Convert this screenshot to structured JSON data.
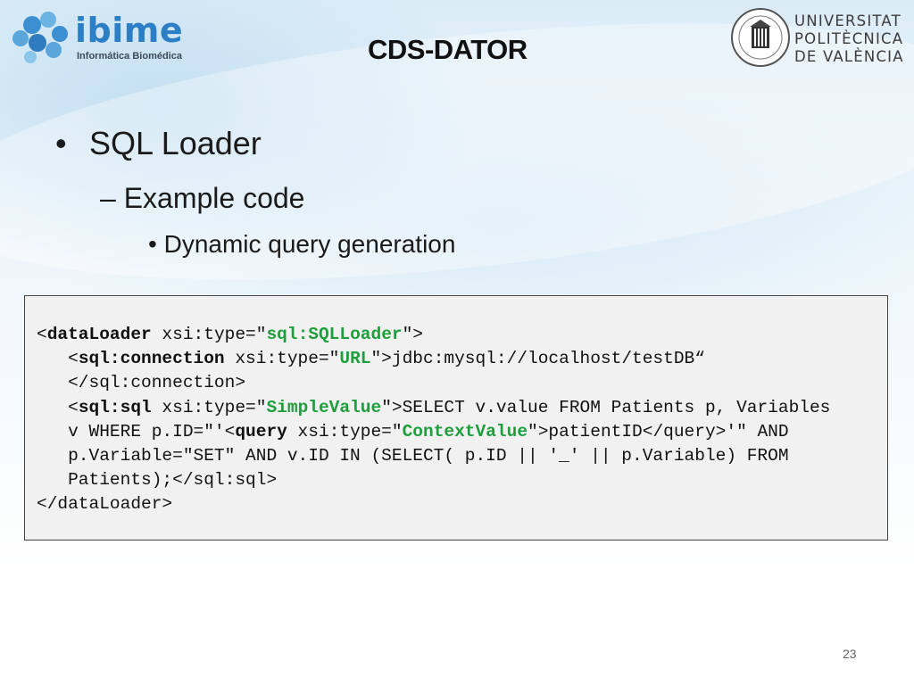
{
  "header": {
    "logo_name": "ibime",
    "logo_subtitle": "Informática Biomédica",
    "title": "CDS-DATOR",
    "university": [
      "UNIVERSITAT",
      "POLITÈCNICA",
      "DE VALÈNCIA"
    ]
  },
  "bullets": {
    "level1": "SQL Loader",
    "level2": "Example code",
    "level3": "Dynamic query generation"
  },
  "code": {
    "l1_a": "<",
    "l1_tag": "dataLoader",
    "l1_b": " xsi:type=\"",
    "l1_val": "sql:SQLLoader",
    "l1_c": "\">",
    "l2_a": "   <",
    "l2_tag": "sql:connection",
    "l2_b": " xsi:type=\"",
    "l2_val": "URL",
    "l2_c": "\">jdbc:mysql://localhost/testDB“",
    "l3": "   </sql:connection>",
    "l4_a": "   <",
    "l4_tag": "sql:sql",
    "l4_b": " xsi:type=\"",
    "l4_val": "SimpleValue",
    "l4_c": "\">SELECT v.value FROM Patients p, Variables",
    "l5_a": "   v WHERE p.ID=\"'<",
    "l5_tag": "query",
    "l5_b": " xsi:type=\"",
    "l5_val": "ContextValue",
    "l5_c": "\">patientID</query>'\" AND",
    "l6": "   p.Variable=\"SET\" AND v.ID IN (SELECT( p.ID || '_' || p.Variable) FROM",
    "l7": "   Patients);</sql:sql>",
    "l8": "</dataLoader>"
  },
  "page_number": "23",
  "colors": {
    "logo_blue": "#2c7fc4",
    "code_value_green": "#1e9e3c",
    "code_bg": "#f1f1f1"
  }
}
